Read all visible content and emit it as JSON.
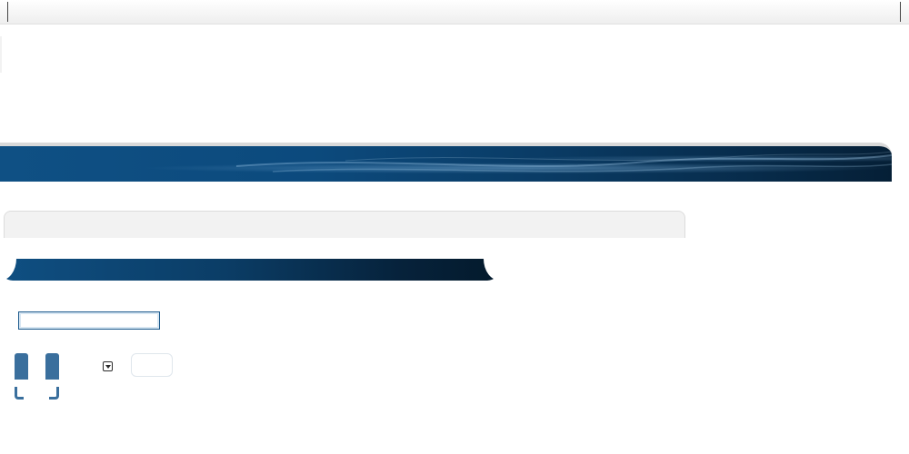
{
  "top_bar": {
    "label": ""
  },
  "banner": {
    "title": ""
  },
  "strip_panel": {
    "label": ""
  },
  "section_bar": {
    "title": ""
  },
  "form": {
    "text_input": {
      "value": "",
      "placeholder": ""
    },
    "toggle_left_label": "",
    "toggle_right_label": "",
    "dropdown": {
      "selected": ""
    },
    "small_box_label": ""
  },
  "colors": {
    "banner_start": "#0f5084",
    "banner_end": "#051f36",
    "section_bar_start": "#0f4f82",
    "section_bar_end": "#041a2c",
    "accent": "#3a6f9d",
    "input_border": "#1e5b8d"
  },
  "icons": {
    "dropdown": "chevron-down-icon"
  }
}
